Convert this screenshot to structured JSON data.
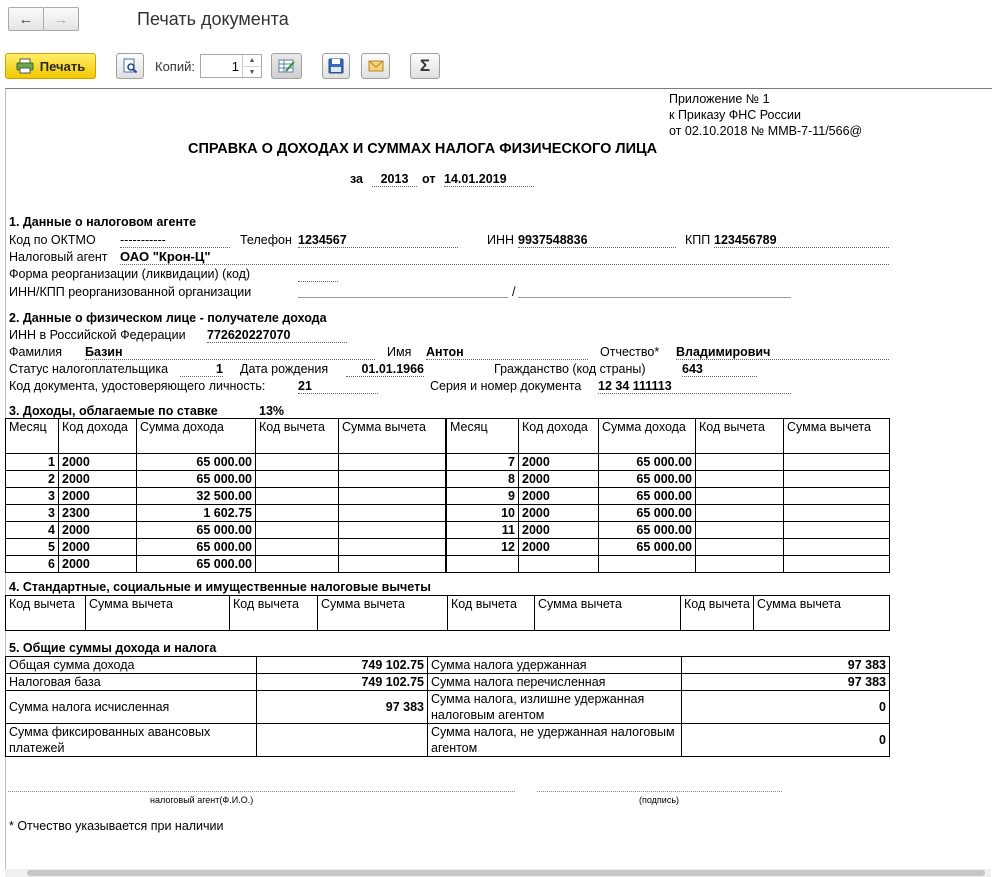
{
  "window": {
    "title": "Печать документа"
  },
  "nav": {
    "back_icon": "arrow-left-icon",
    "forward_icon": "arrow-right-icon"
  },
  "toolbar": {
    "print_label": "Печать",
    "copies_label": "Копий:",
    "copies_value": "1",
    "sigma": "Σ"
  },
  "doc": {
    "appendix": {
      "line1": "Приложение № 1",
      "line2": "к Приказу ФНС России",
      "line3": "от 02.10.2018 № ММВ-7-11/566@"
    },
    "title": "СПРАВКА О ДОХОДАХ И СУММАХ НАЛОГА ФИЗИЧЕСКОГО ЛИЦА",
    "period": {
      "za": "за",
      "year": "2013",
      "ot": "от",
      "date": "14.01.2019"
    },
    "s1": {
      "heading": "1. Данные о налоговом агенте",
      "oktmo_label": "Код по ОКТМО",
      "oktmo_value": "-----------",
      "phone_label": "Телефон",
      "phone_value": "1234567",
      "inn_label": "ИНН",
      "inn_value": "9937548836",
      "kpp_label": "КПП",
      "kpp_value": "123456789",
      "agent_label": "Налоговый агент",
      "agent_value": "ОАО \"Крон-Ц\"",
      "reorg_label": "Форма реорганизации (ликвидации)  (код)",
      "reorg_inn_label": "ИНН/КПП  реорганизованной организации",
      "slash": "/"
    },
    "s2": {
      "heading": "2. Данные о физическом лице - получателе дохода",
      "inn_label": "ИНН в Российской Федерации",
      "inn_value": "772620227070",
      "surname_label": "Фамилия",
      "surname_value": "Базин",
      "name_label": "Имя",
      "name_value": "Антон",
      "patronymic_label": "Отчество*",
      "patronymic_value": "Владимирович",
      "status_label": "Статус налогоплательщика",
      "status_value": "1",
      "dob_label": "Дата рождения",
      "dob_value": "01.01.1966",
      "citizenship_label": "Гражданство (код страны)",
      "citizenship_value": "643",
      "doccode_label": "Код документа, удостоверяющего личность:",
      "doccode_value": "21",
      "docnum_label": "Серия и номер документа",
      "docnum_value": "12 34 111113"
    },
    "s3": {
      "heading": "3. Доходы, облагаемые по ставке",
      "rate": "13%",
      "headers": [
        "Месяц",
        "Код дохода",
        "Сумма дохода",
        "Код вычета",
        "Сумма вычета"
      ],
      "left_rows": [
        [
          "1",
          "2000",
          "65 000.00",
          "",
          ""
        ],
        [
          "2",
          "2000",
          "65 000.00",
          "",
          ""
        ],
        [
          "3",
          "2000",
          "32 500.00",
          "",
          ""
        ],
        [
          "3",
          "2300",
          "1 602.75",
          "",
          ""
        ],
        [
          "4",
          "2000",
          "65 000.00",
          "",
          ""
        ],
        [
          "5",
          "2000",
          "65 000.00",
          "",
          ""
        ],
        [
          "6",
          "2000",
          "65 000.00",
          "",
          ""
        ]
      ],
      "right_rows": [
        [
          "7",
          "2000",
          "65 000.00",
          "",
          ""
        ],
        [
          "8",
          "2000",
          "65 000.00",
          "",
          ""
        ],
        [
          "9",
          "2000",
          "65 000.00",
          "",
          ""
        ],
        [
          "10",
          "2000",
          "65 000.00",
          "",
          ""
        ],
        [
          "11",
          "2000",
          "65 000.00",
          "",
          ""
        ],
        [
          "12",
          "2000",
          "65 000.00",
          "",
          ""
        ],
        [
          "",
          "",
          "",
          "",
          ""
        ]
      ]
    },
    "s4": {
      "heading": "4. Стандартные, социальные и имущественные налоговые вычеты",
      "headers": [
        "Код вычета",
        "Сумма вычета",
        "Код вычета",
        "Сумма вычета",
        "Код вычета",
        "Сумма вычета",
        "Код вычета",
        "Сумма вычета"
      ]
    },
    "s5": {
      "heading": "5. Общие суммы дохода и налога",
      "total_income_label": "Общая сумма дохода",
      "total_income": "749 102.75",
      "tax_base_label": "Налоговая база",
      "tax_base": "749 102.75",
      "tax_calc_label": "Сумма налога исчисленная",
      "tax_calc": "97 383",
      "fixed_label": "Сумма фиксированных авансовых платежей",
      "fixed": "",
      "withheld_label": "Сумма налога удержанная",
      "withheld": "97 383",
      "transferred_label": "Сумма налога перечисленная",
      "transferred": "97 383",
      "over_label": "Сумма налога, излишне удержанная налоговым агентом",
      "over": "0",
      "not_withheld_label": "Сумма налога, не удержанная налоговым агентом",
      "not_withheld": "0"
    },
    "signature": {
      "agent_caption": "налоговый агент(Ф.И.О.)",
      "sign_caption": "(подпись)"
    },
    "footnote": "* Отчество указывается при наличии"
  }
}
